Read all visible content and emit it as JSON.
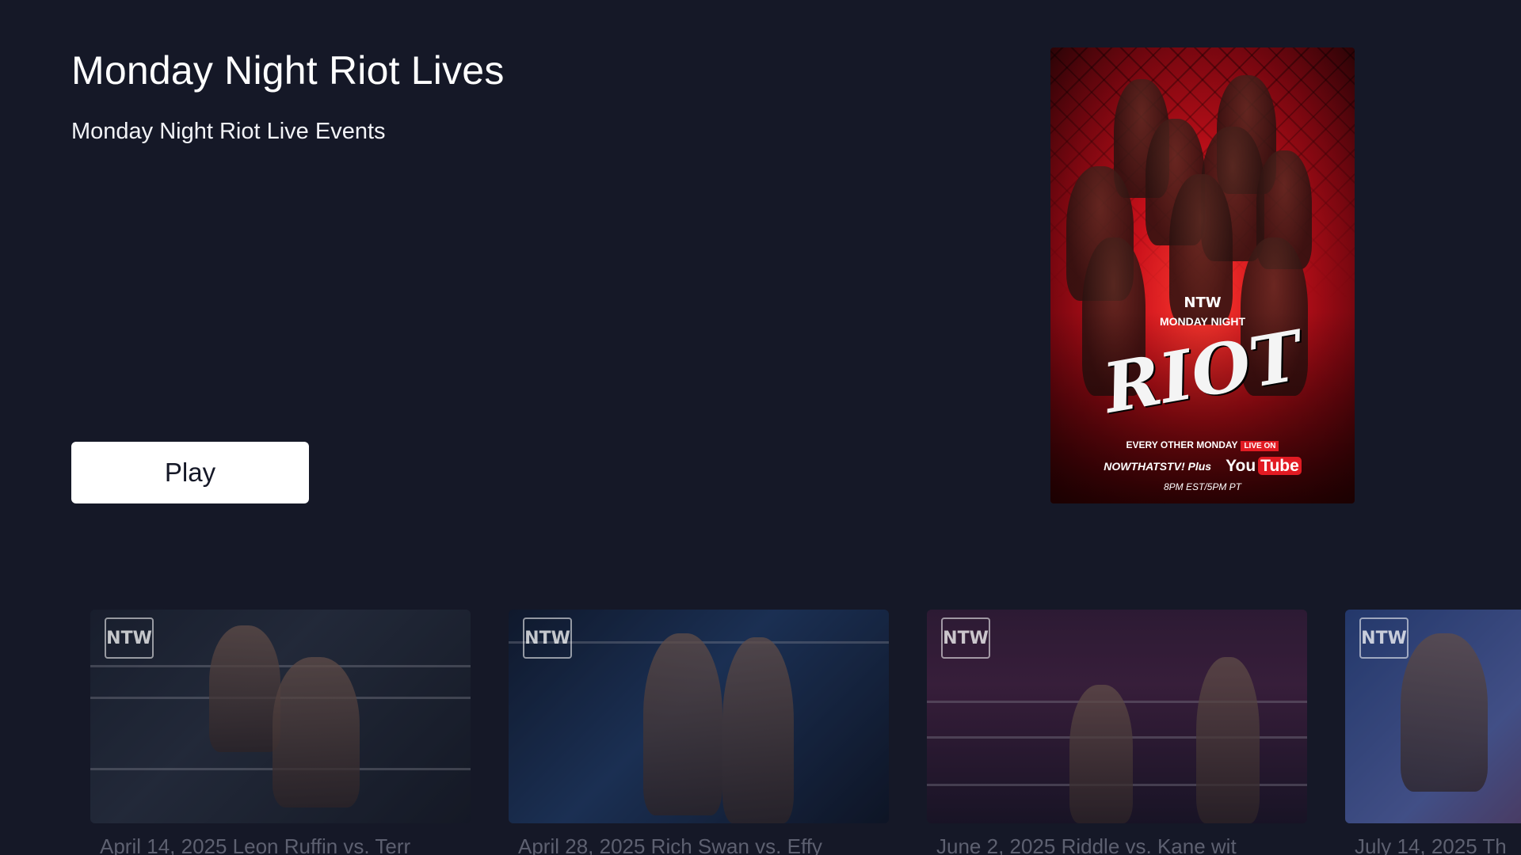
{
  "hero": {
    "title": "Monday Night Riot Lives",
    "subtitle": "Monday Night Riot Live Events",
    "play_label": "Play"
  },
  "poster": {
    "logo_text": "NTW",
    "logo_subtitle": "MONDAY NIGHT",
    "title_text": "RIOT",
    "tagline": "EVERY OTHER MONDAY",
    "live_badge": "LIVE ON",
    "platform_1": "NOWTHATSTV! Plus",
    "platform_2_a": "You",
    "platform_2_b": "Tube",
    "time": "8PM EST/5PM PT"
  },
  "rail": {
    "items": [
      {
        "badge": "NTW",
        "label": "April 14, 2025 Leon Ruffin vs. Terr"
      },
      {
        "badge": "NTW",
        "label": "April 28, 2025 Rich Swan vs. Effy"
      },
      {
        "badge": "NTW",
        "label": "June 2, 2025 Riddle vs. Kane wit"
      },
      {
        "badge": "NTW",
        "label": "July 14, 2025 Th"
      }
    ]
  },
  "colors": {
    "background": "#151827",
    "play_button": "#ffffff",
    "caption": "#5d6070"
  }
}
